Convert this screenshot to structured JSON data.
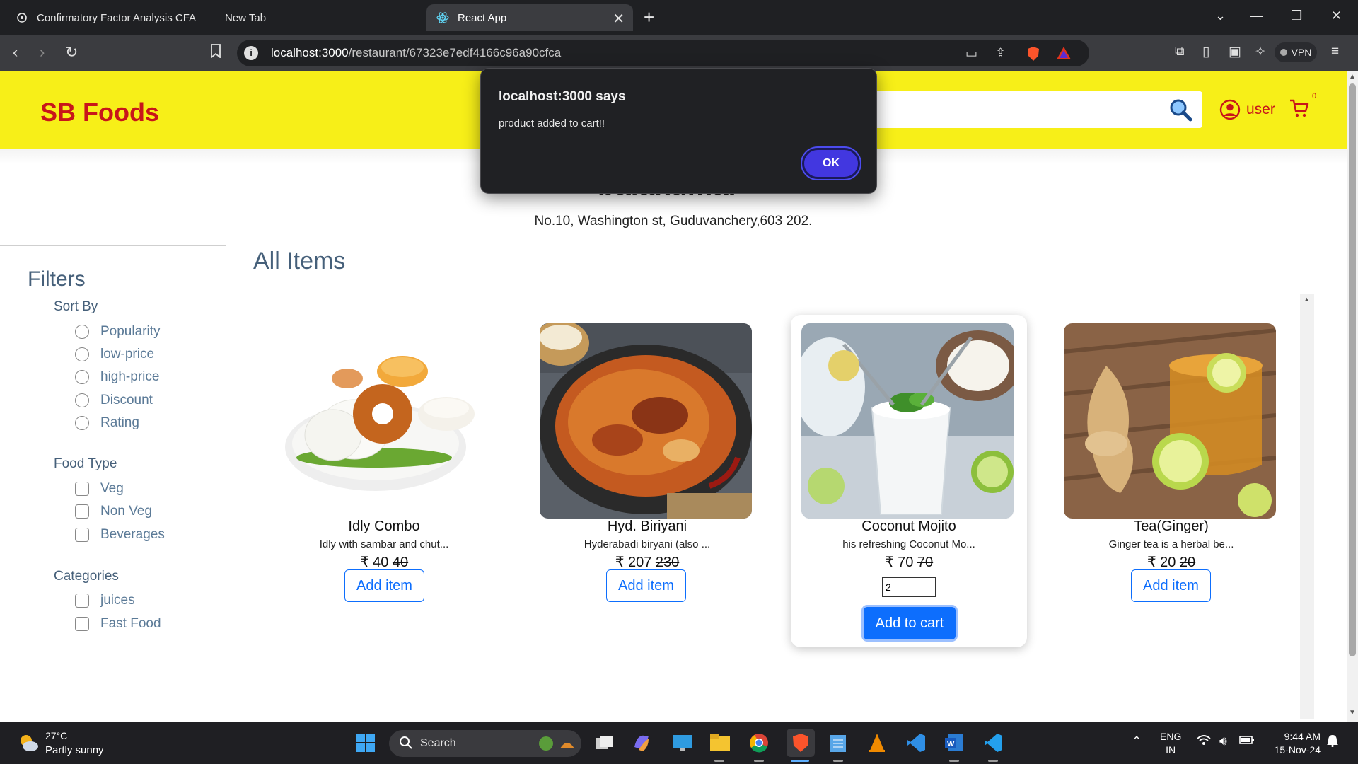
{
  "browser": {
    "tabs": [
      {
        "label": "Confirmatory Factor Analysis CFA",
        "active": false
      },
      {
        "label": "New Tab",
        "active": false
      },
      {
        "label": "React App",
        "active": true
      }
    ],
    "url_host": "localhost:3000",
    "url_path": "/restaurant/67323e7edf4166c96a90cfca",
    "vpn_label": "VPN"
  },
  "header": {
    "logo": "SB Foods",
    "search_placeholder": "",
    "user_label": "user",
    "cart_count": "0"
  },
  "restaurant": {
    "title": "balakumar",
    "address": "No.10, Washington st, Guduvanchery,603 202."
  },
  "filters": {
    "title": "Filters",
    "sort_title": "Sort By",
    "sort_options": [
      "Popularity",
      "low-price",
      "high-price",
      "Discount",
      "Rating"
    ],
    "food_type_title": "Food Type",
    "food_types": [
      "Veg",
      "Non Veg",
      "Beverages"
    ],
    "categories_title": "Categories",
    "categories": [
      "juices",
      "Fast Food"
    ]
  },
  "items_title": "All Items",
  "items": [
    {
      "name": "Idly Combo",
      "desc": "Idly with sambar and chut...",
      "price": "₹ 40",
      "old_price": "40",
      "button": "Add item"
    },
    {
      "name": "Hyd. Biriyani",
      "desc": "Hyderabadi biryani (also ...",
      "price": "₹ 207",
      "old_price": "230",
      "button": "Add item"
    },
    {
      "name": "Coconut Mojito",
      "desc": "his refreshing Coconut Mo...",
      "price": "₹ 70",
      "old_price": "70",
      "qty": "2",
      "button": "Add to cart"
    },
    {
      "name": "Tea(Ginger)",
      "desc": "Ginger tea is a herbal be...",
      "price": "₹ 20",
      "old_price": "20",
      "button": "Add item"
    }
  ],
  "dialog": {
    "title": "localhost:3000 says",
    "message": "product added to cart!!",
    "ok": "OK"
  },
  "taskbar": {
    "weather_temp": "27°C",
    "weather_desc": "Partly sunny",
    "search_label": "Search",
    "lang_line1": "ENG",
    "lang_line2": "IN",
    "time": "9:44 AM",
    "date": "15-Nov-24"
  },
  "colors": {
    "header_bg": "#f7ef18",
    "logo": "#c8161a",
    "accent_blue": "#0d6efd",
    "filter_text": "#46607a",
    "dialog_bg": "#202124",
    "dialog_ok": "#4237e0"
  }
}
